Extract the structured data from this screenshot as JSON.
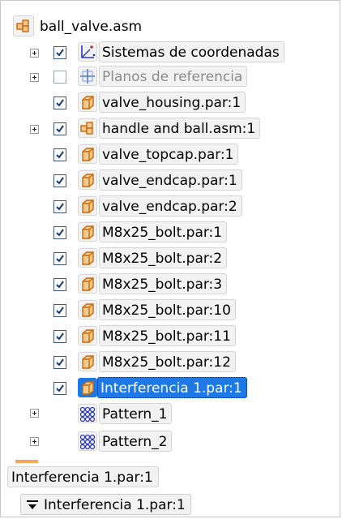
{
  "tree": {
    "root_label": "ball_valve.asm",
    "items": [
      {
        "label": "Sistemas de coordenadas",
        "icon": "coordinate-system-icon",
        "checked": true,
        "expandable": true
      },
      {
        "label": "Planos de referencia",
        "icon": "reference-plane-icon",
        "checked": false,
        "expandable": true
      },
      {
        "label": "valve_housing.par:1",
        "icon": "part-icon",
        "checked": true,
        "expandable": false
      },
      {
        "label": "handle and ball.asm:1",
        "icon": "assembly-icon",
        "checked": true,
        "expandable": true
      },
      {
        "label": "valve_topcap.par:1",
        "icon": "part-icon",
        "checked": true,
        "expandable": false
      },
      {
        "label": "valve_endcap.par:1",
        "icon": "part-icon",
        "checked": true,
        "expandable": false
      },
      {
        "label": "valve_endcap.par:2",
        "icon": "part-icon",
        "checked": true,
        "expandable": false
      },
      {
        "label": "M8x25_bolt.par:1",
        "icon": "part-icon",
        "checked": true,
        "expandable": false
      },
      {
        "label": "M8x25_bolt.par:2",
        "icon": "part-icon",
        "checked": true,
        "expandable": false
      },
      {
        "label": "M8x25_bolt.par:3",
        "icon": "part-icon",
        "checked": true,
        "expandable": false
      },
      {
        "label": "M8x25_bolt.par:10",
        "icon": "part-icon",
        "checked": true,
        "expandable": false
      },
      {
        "label": "M8x25_bolt.par:11",
        "icon": "part-icon",
        "checked": true,
        "expandable": false
      },
      {
        "label": "M8x25_bolt.par:12",
        "icon": "part-icon",
        "checked": true,
        "expandable": false
      },
      {
        "label": "Interferencia 1.par:1",
        "icon": "part-icon",
        "checked": true,
        "expandable": false,
        "selected": true
      },
      {
        "label": "Pattern_1",
        "icon": "pattern-icon",
        "expandable": true
      },
      {
        "label": "Pattern_2",
        "icon": "pattern-icon",
        "expandable": true
      }
    ]
  },
  "status": {
    "selected_label": "Interferencia 1.par:1",
    "dropdown_label": "Interferencia 1.par:1"
  },
  "colors": {
    "selection": "#1e78e6",
    "part_orange": "#f0a030",
    "divider": "#f7a55a"
  }
}
